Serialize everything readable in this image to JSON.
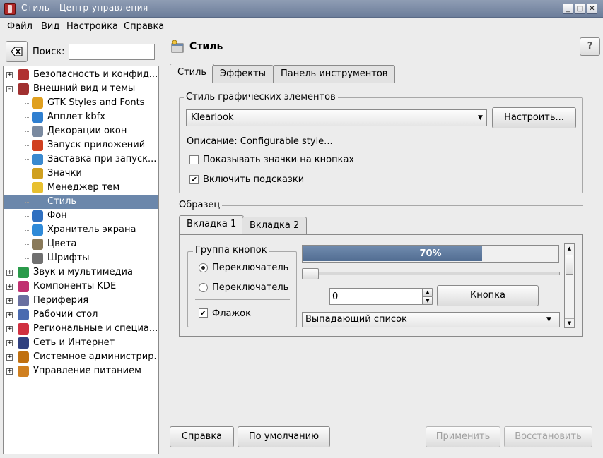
{
  "window": {
    "title": "Стиль - Центр управления",
    "min_icon": "minimize-icon",
    "max_icon": "maximize-icon",
    "close_icon": "close-icon"
  },
  "menu": {
    "file": "Файл",
    "view": "Вид",
    "settings": "Настройка",
    "help": "Справка"
  },
  "search": {
    "label": "Поиск:",
    "value": ""
  },
  "tree": [
    {
      "label": "Безопасность и конфид...",
      "icon": "security-icon",
      "level": 0,
      "expander": "+"
    },
    {
      "label": "Внешний вид и темы",
      "icon": "appearance-icon",
      "level": 0,
      "expander": "-"
    },
    {
      "label": "GTK Styles and Fonts",
      "icon": "gtk-icon",
      "level": 1
    },
    {
      "label": "Апплет kbfx",
      "icon": "kbfx-icon",
      "level": 1
    },
    {
      "label": "Декорации окон",
      "icon": "window-decorations-icon",
      "level": 1
    },
    {
      "label": "Запуск приложений",
      "icon": "launch-icon",
      "level": 1
    },
    {
      "label": "Заставка при запуск...",
      "icon": "splash-icon",
      "level": 1
    },
    {
      "label": "Значки",
      "icon": "icons-icon",
      "level": 1
    },
    {
      "label": "Менеджер тем",
      "icon": "theme-manager-icon",
      "level": 1
    },
    {
      "label": "Стиль",
      "icon": "style-icon",
      "level": 1,
      "selected": true
    },
    {
      "label": "Фон",
      "icon": "background-icon",
      "level": 1
    },
    {
      "label": "Хранитель экрана",
      "icon": "screensaver-icon",
      "level": 1
    },
    {
      "label": "Цвета",
      "icon": "colors-icon",
      "level": 1
    },
    {
      "label": "Шрифты",
      "icon": "fonts-icon",
      "level": 1
    },
    {
      "label": "Звук и мультимедиа",
      "icon": "sound-icon",
      "level": 0,
      "expander": "+"
    },
    {
      "label": "Компоненты KDE",
      "icon": "kde-components-icon",
      "level": 0,
      "expander": "+"
    },
    {
      "label": "Периферия",
      "icon": "peripherals-icon",
      "level": 0,
      "expander": "+"
    },
    {
      "label": "Рабочий стол",
      "icon": "desktop-icon",
      "level": 0,
      "expander": "+"
    },
    {
      "label": "Региональные и специа...",
      "icon": "regional-icon",
      "level": 0,
      "expander": "+"
    },
    {
      "label": "Сеть и Интернет",
      "icon": "network-icon",
      "level": 0,
      "expander": "+"
    },
    {
      "label": "Системное администрир...",
      "icon": "sysadmin-icon",
      "level": 0,
      "expander": "+"
    },
    {
      "label": "Управление питанием",
      "icon": "power-icon",
      "level": 0,
      "expander": "+"
    }
  ],
  "header": {
    "title": "Стиль",
    "help_glyph": "?"
  },
  "tabs": [
    "Стиль",
    "Эффекты",
    "Панель инструментов"
  ],
  "widget_style": {
    "legend": "Стиль графических элементов",
    "selected": "Klearlook",
    "configure": "Настроить...",
    "description": "Описание: Configurable style...",
    "show_icons": "Показывать значки на кнопках",
    "show_icons_checked": false,
    "tooltips": "Включить подсказки",
    "tooltips_checked": true
  },
  "preview": {
    "legend": "Образец",
    "tabs": [
      "Вкладка 1",
      "Вкладка 2"
    ],
    "button_group": "Группа кнопок",
    "radio1": "Переключатель",
    "radio2": "Переключатель",
    "checkbox": "Флажок",
    "progress_text": "70%",
    "progress_value": 0.7,
    "spin_value": "0",
    "button": "Кнопка",
    "combo": "Выпадающий список"
  },
  "footer": {
    "help": "Справка",
    "defaults": "По умолчанию",
    "apply": "Применить",
    "reset": "Восстановить"
  },
  "colors": {
    "selection": "#6b87ab",
    "progress": "#5e7a9b",
    "titlebar": "#7b8aa6"
  }
}
